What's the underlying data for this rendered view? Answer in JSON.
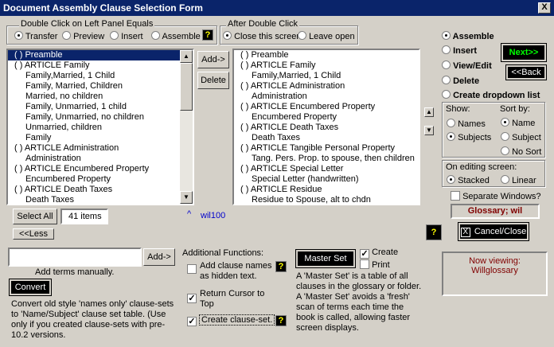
{
  "window": {
    "title": "Document Assembly Clause Selection Form",
    "close": "X"
  },
  "dbl_left": {
    "label": "Double Click on Left Panel Equals",
    "options": [
      "Transfer",
      "Preview",
      "Insert",
      "Assemble"
    ],
    "help": "?"
  },
  "after_dbl": {
    "label": "After Double Click",
    "options": [
      "Close this screen",
      "Leave open"
    ]
  },
  "left_list": {
    "items": [
      "( ) Preamble",
      "( ) ARTICLE Family",
      "Family,Married,  1 Child",
      "Family, Married, Children",
      "Married, no children",
      "Family, Unmarried, 1 child",
      "Family, Unmarried, no children",
      "Unmarried, children",
      "Family",
      "( ) ARTICLE Administration",
      "Administration",
      "( ) ARTICLE Encumbered Property",
      "Encumbered Property",
      "( ) ARTICLE Death Taxes",
      "Death Taxes"
    ]
  },
  "right_list": {
    "items": [
      "( ) Preamble",
      "( ) ARTICLE Family",
      "Family,Married,  1 Child",
      "( ) ARTICLE Administration",
      "Administration",
      "( ) ARTICLE Encumbered Property",
      "Encumbered Property",
      "( ) ARTICLE Death Taxes",
      "Death Taxes",
      "( )  ARTICLE Tangible Personal Property",
      "Tang. Pers. Prop. to spouse, then children",
      "( ) ARTICLE Special Letter",
      "Special Letter (handwritten)",
      "( ) ARTICLE Residue",
      "Residue to Spouse, alt to chdn"
    ]
  },
  "mid_buttons": {
    "add": "Add->",
    "delete": "Delete"
  },
  "select_all": "Select All",
  "items_count": "41 items",
  "caret": "^",
  "file_name": "wil100",
  "less_btn": "<<Less",
  "manual_add": {
    "value": "",
    "button": "Add->",
    "label": "Add terms manually."
  },
  "convert": {
    "button": "Convert",
    "text": "Convert old style 'names only' clause-sets to 'Name/Subject' clause set table. (Use only if you created clause-sets with pre-10.2 versions."
  },
  "additional": {
    "title": "Additional Functions:",
    "opt1": "Add clause names as hidden text.",
    "opt2": "Return Cursor to Top",
    "opt3": "Create clause-set.",
    "help": "?",
    "check": "✓"
  },
  "master_set": {
    "button": "Master Set",
    "create": "Create",
    "print": "Print",
    "text": "A 'Master Set' is a table of all clauses in the glossary or folder.  A 'Master Set' avoids a 'fresh' scan of terms each time the book is called, allowing faster screen displays."
  },
  "mode_options": [
    "Assemble",
    "Insert",
    "View/Edit",
    "Delete",
    "Create dropdown list"
  ],
  "next_btn": "Next>>",
  "back_btn": "<<Back",
  "show": {
    "label": "Show:",
    "options": [
      "Names",
      "Subjects"
    ]
  },
  "sort": {
    "label": "Sort by:",
    "options": [
      "Name",
      "Subject",
      "No Sort"
    ]
  },
  "editing": {
    "label": "On editing screen:",
    "options": [
      "Stacked",
      "Linear"
    ]
  },
  "separate_windows": "Separate Windows?",
  "glossary_label": "Glossary; wil",
  "help_q": "?",
  "cancel": {
    "icon": "X",
    "label": "Cancel/Close"
  },
  "viewing": {
    "label": "Now viewing:",
    "value": "Willglossary"
  },
  "scroll_up": "▲",
  "scroll_down": "▼"
}
